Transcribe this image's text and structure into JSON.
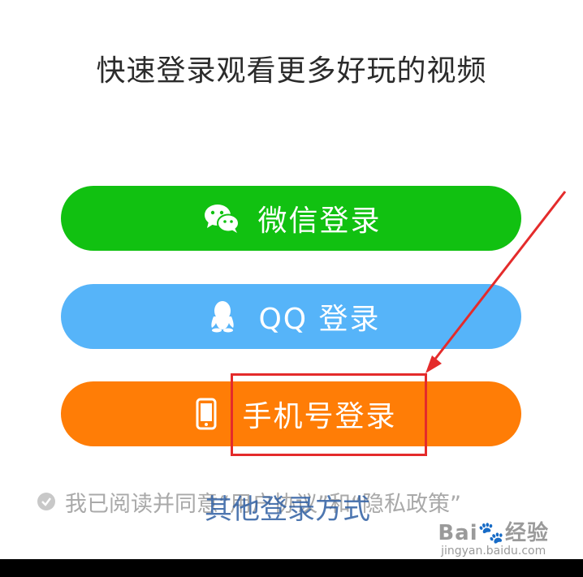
{
  "title": "快速登录观看更多好玩的视频",
  "buttons": {
    "wechat": {
      "label": "微信登录",
      "icon": "wechat-icon",
      "color": "#11c111"
    },
    "qq": {
      "label": "QQ 登录",
      "icon": "qq-penguin-icon",
      "color": "#56b4f9"
    },
    "phone": {
      "label": "手机号登录",
      "icon": "phone-icon",
      "color": "#ff7d06"
    }
  },
  "agreement": {
    "prefix": "我已阅读并同意",
    "user_agreement": "“用户协议”",
    "conjunction": "和",
    "privacy_policy": "“隐私政策”"
  },
  "other_login": "其他登录方式",
  "watermark": {
    "main": "Bai",
    "main_suffix": "经验",
    "sub": "jingyan.baidu.com"
  },
  "annotation": {
    "box_color": "#e42b2b"
  }
}
